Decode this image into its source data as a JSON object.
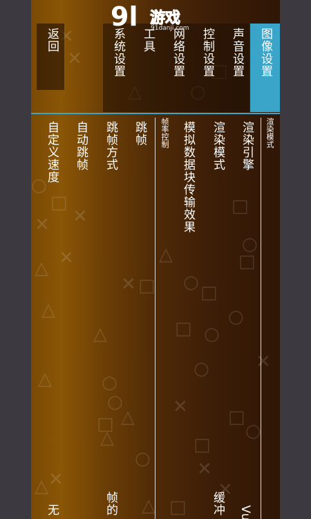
{
  "watermark": {
    "logo_number": "9l",
    "logo_text": "游戏",
    "logo_sub": "91danji.com"
  },
  "menu": {
    "active_tab": "图像设置",
    "tabs": [
      "声音设置",
      "控制设置",
      "网络设置",
      "工具",
      "系统设置"
    ],
    "back": "返回"
  },
  "render_section": {
    "header": "渲染模式",
    "items": [
      "渲染引擎",
      "渲染模式",
      "模拟数据块传输效果"
    ]
  },
  "frameskip_section": {
    "header": "帧率控制",
    "items": [
      "跳帧",
      "跳帧方式",
      "自动跳帧",
      "自定义速度"
    ]
  },
  "value_fragments": {
    "engine_value": "Vu",
    "mode_value": "缓冲",
    "frameskip_mode_value": "帧的",
    "custom_speed_value": "无"
  },
  "colors": {
    "accent": "#3aa5c9",
    "bezel": "#3c3a40"
  }
}
